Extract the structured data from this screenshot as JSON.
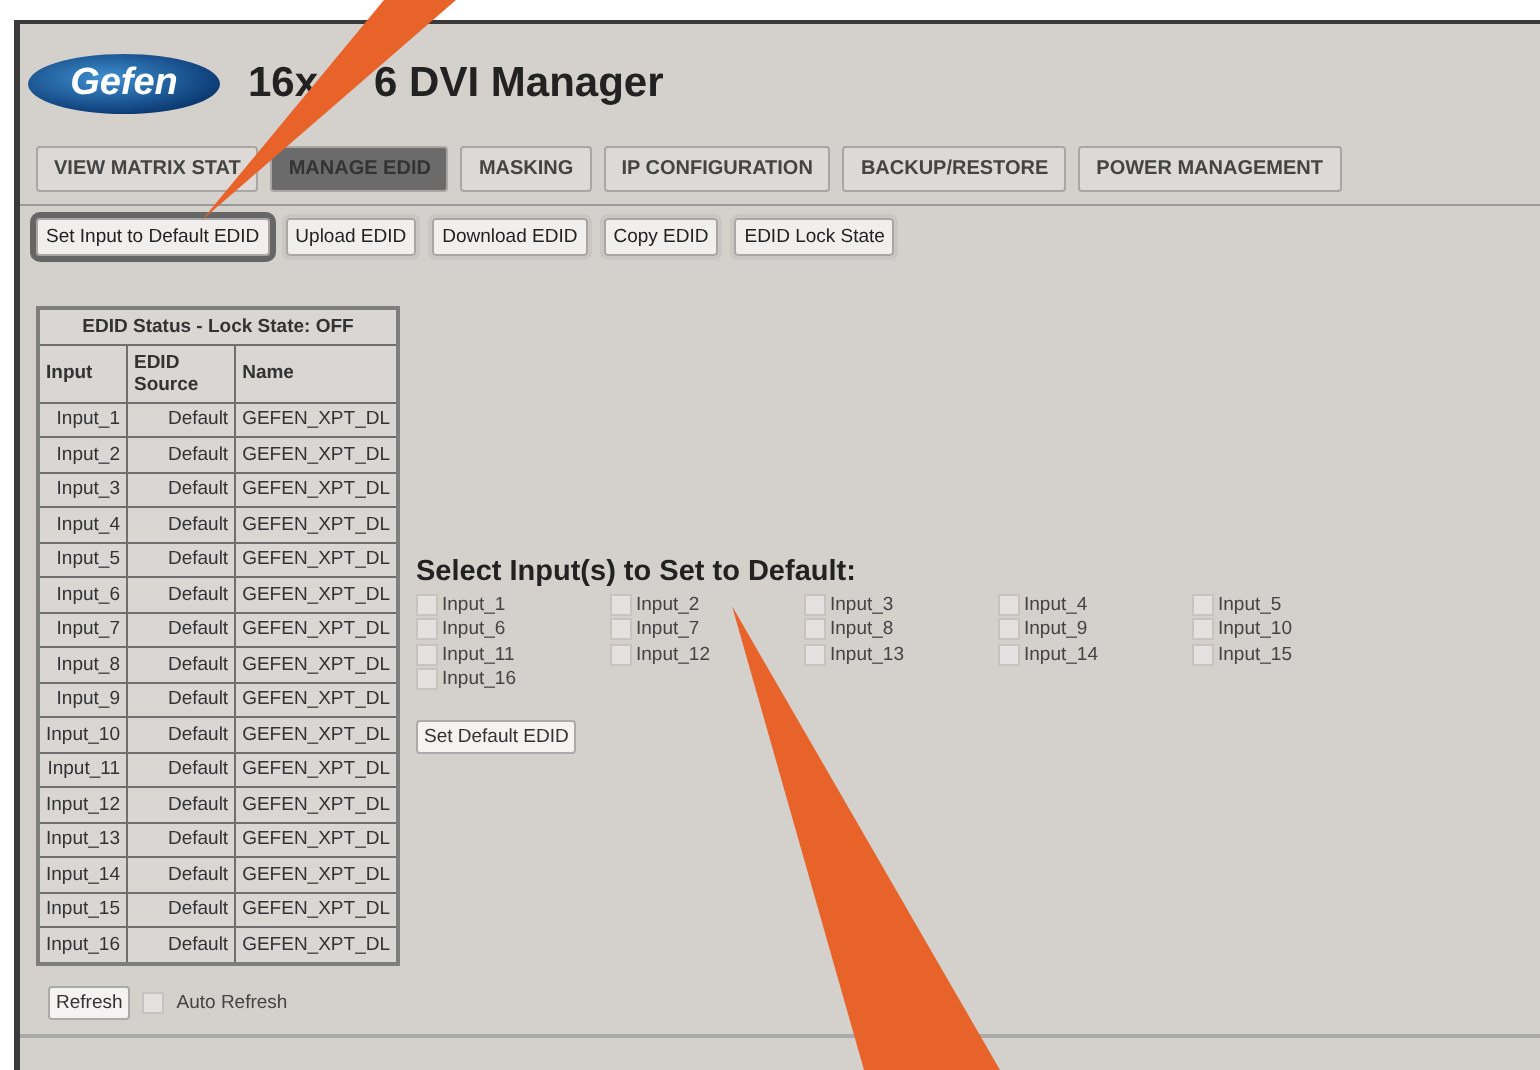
{
  "logo": {
    "text": "Gefen"
  },
  "title": {
    "before": "16x",
    "after": "6 DVI Manager"
  },
  "tabs": [
    {
      "label": "VIEW MATRIX STAT",
      "selected": false
    },
    {
      "label": "MANAGE EDID",
      "selected": true
    },
    {
      "label": "MASKING",
      "selected": false
    },
    {
      "label": "IP CONFIGURATION",
      "selected": false
    },
    {
      "label": "BACKUP/RESTORE",
      "selected": false
    },
    {
      "label": "POWER MANAGEMENT",
      "selected": false
    }
  ],
  "actions": [
    {
      "label": "Set Input to Default EDID",
      "selected": true
    },
    {
      "label": "Upload EDID",
      "selected": false
    },
    {
      "label": "Download EDID",
      "selected": false
    },
    {
      "label": "Copy EDID",
      "selected": false
    },
    {
      "label": "EDID Lock State",
      "selected": false
    }
  ],
  "table": {
    "caption": "EDID Status - Lock State: OFF",
    "columns": [
      "Input",
      "EDID Source",
      "Name"
    ],
    "rows": [
      [
        "Input_1",
        "Default",
        "GEFEN_XPT_DL"
      ],
      [
        "Input_2",
        "Default",
        "GEFEN_XPT_DL"
      ],
      [
        "Input_3",
        "Default",
        "GEFEN_XPT_DL"
      ],
      [
        "Input_4",
        "Default",
        "GEFEN_XPT_DL"
      ],
      [
        "Input_5",
        "Default",
        "GEFEN_XPT_DL"
      ],
      [
        "Input_6",
        "Default",
        "GEFEN_XPT_DL"
      ],
      [
        "Input_7",
        "Default",
        "GEFEN_XPT_DL"
      ],
      [
        "Input_8",
        "Default",
        "GEFEN_XPT_DL"
      ],
      [
        "Input_9",
        "Default",
        "GEFEN_XPT_DL"
      ],
      [
        "Input_10",
        "Default",
        "GEFEN_XPT_DL"
      ],
      [
        "Input_11",
        "Default",
        "GEFEN_XPT_DL"
      ],
      [
        "Input_12",
        "Default",
        "GEFEN_XPT_DL"
      ],
      [
        "Input_13",
        "Default",
        "GEFEN_XPT_DL"
      ],
      [
        "Input_14",
        "Default",
        "GEFEN_XPT_DL"
      ],
      [
        "Input_15",
        "Default",
        "GEFEN_XPT_DL"
      ],
      [
        "Input_16",
        "Default",
        "GEFEN_XPT_DL"
      ]
    ]
  },
  "refresh": {
    "button": "Refresh",
    "auto_label": "Auto Refresh",
    "auto_checked": false
  },
  "select": {
    "heading": "Select Input(s) to Set to Default:",
    "inputs": [
      {
        "label": "Input_1",
        "checked": false
      },
      {
        "label": "Input_2",
        "checked": false
      },
      {
        "label": "Input_3",
        "checked": false
      },
      {
        "label": "Input_4",
        "checked": false
      },
      {
        "label": "Input_5",
        "checked": false
      },
      {
        "label": "Input_6",
        "checked": false
      },
      {
        "label": "Input_7",
        "checked": false
      },
      {
        "label": "Input_8",
        "checked": false
      },
      {
        "label": "Input_9",
        "checked": false
      },
      {
        "label": "Input_10",
        "checked": false
      },
      {
        "label": "Input_11",
        "checked": false
      },
      {
        "label": "Input_12",
        "checked": false
      },
      {
        "label": "Input_13",
        "checked": false
      },
      {
        "label": "Input_14",
        "checked": false
      },
      {
        "label": "Input_15",
        "checked": false
      },
      {
        "label": "Input_16",
        "checked": false
      }
    ],
    "button": "Set Default EDID"
  }
}
